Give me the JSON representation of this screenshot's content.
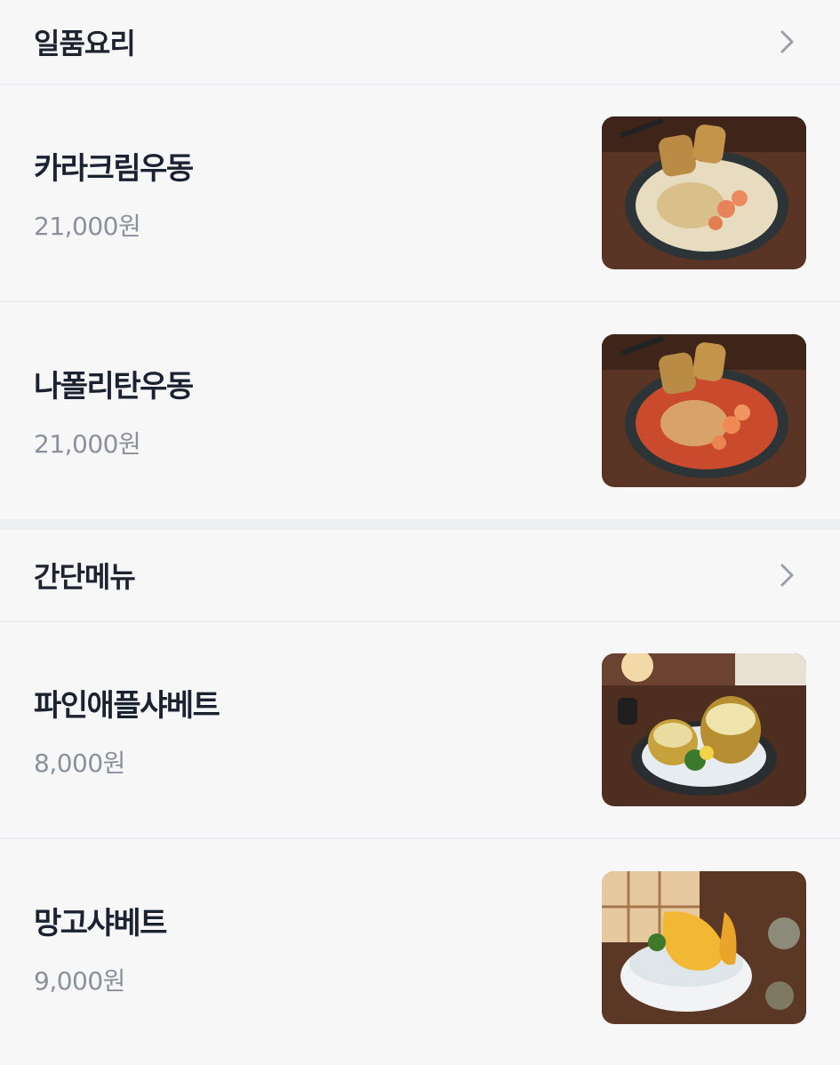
{
  "sections": [
    {
      "title": "일품요리",
      "items": [
        {
          "name": "카라크림우동",
          "price": "21,000원",
          "image": "cream-udon-photo"
        },
        {
          "name": "나폴리탄우동",
          "price": "21,000원",
          "image": "napolitan-udon-photo"
        }
      ]
    },
    {
      "title": "간단메뉴",
      "items": [
        {
          "name": "파인애플샤베트",
          "price": "8,000원",
          "image": "pineapple-sherbet-photo"
        },
        {
          "name": "망고샤베트",
          "price": "9,000원",
          "image": "mango-sherbet-photo"
        }
      ]
    }
  ],
  "colors": {
    "background": "#f7f7f8",
    "divider": "#eceef1",
    "title": "#1b2232",
    "price": "#8b919b",
    "chevron": "#9aa0a8"
  },
  "icons": {
    "section_more": "chevron-right-icon"
  }
}
